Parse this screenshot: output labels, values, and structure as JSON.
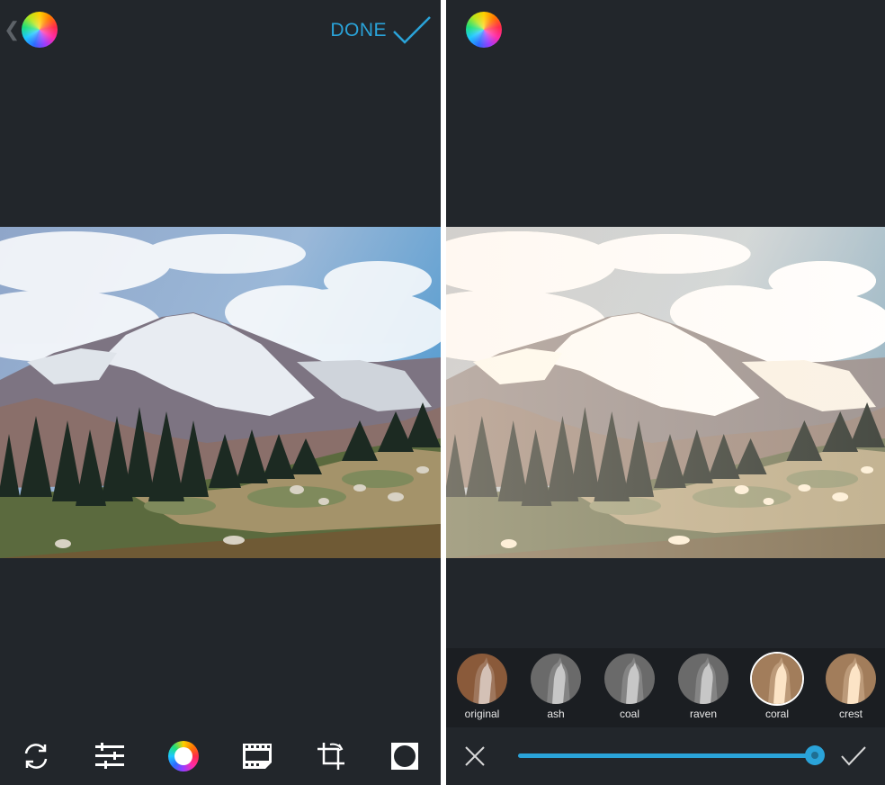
{
  "left_panel": {
    "done_label": "DONE",
    "back_glyph": "❮"
  },
  "right_panel": {
    "filters": [
      {
        "label": "original",
        "tone": "original",
        "selected": false
      },
      {
        "label": "ash",
        "tone": "bw",
        "selected": false
      },
      {
        "label": "coal",
        "tone": "bw",
        "selected": false
      },
      {
        "label": "raven",
        "tone": "bw",
        "selected": false
      },
      {
        "label": "coral",
        "tone": "warm",
        "selected": true
      },
      {
        "label": "crest",
        "tone": "warm",
        "selected": false
      }
    ],
    "intensity_fraction": 1.0
  },
  "icons": {
    "logo": "color-wheel-logo-icon",
    "done": "checkmark-icon",
    "tools": [
      "rotate-icon",
      "adjustments-icon",
      "filters-color-wheel-icon",
      "film-icon",
      "crop-icon",
      "vignette-icon"
    ],
    "cancel": "close-icon",
    "apply": "checkmark-icon"
  },
  "colors": {
    "accent": "#2aa3d9",
    "background": "#22262b",
    "filter_strip": "#1b1e22"
  }
}
